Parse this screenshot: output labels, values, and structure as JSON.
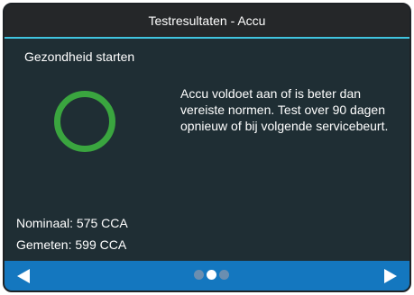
{
  "header": {
    "title": "Testresultaten - Accu"
  },
  "main": {
    "section_title": "Gezondheid starten",
    "status_icon": "status-ring-icon",
    "status_color": "#3aa53f",
    "message": "Accu voldoet aan of is beter dan vereiste normen. Test over 90 dagen opnieuw of bij volgende servicebeurt.",
    "nominal": "Nominaal: 575 CCA",
    "measured": "Gemeten: 599 CCA"
  },
  "footer": {
    "prev_icon": "arrow-left-icon",
    "next_icon": "arrow-right-icon",
    "page_count": 3,
    "active_page": 2
  },
  "colors": {
    "header_bg": "#252729",
    "header_accent": "#40c4df",
    "content_bg": "#1f2e34",
    "footer_bg": "#1477bf"
  }
}
